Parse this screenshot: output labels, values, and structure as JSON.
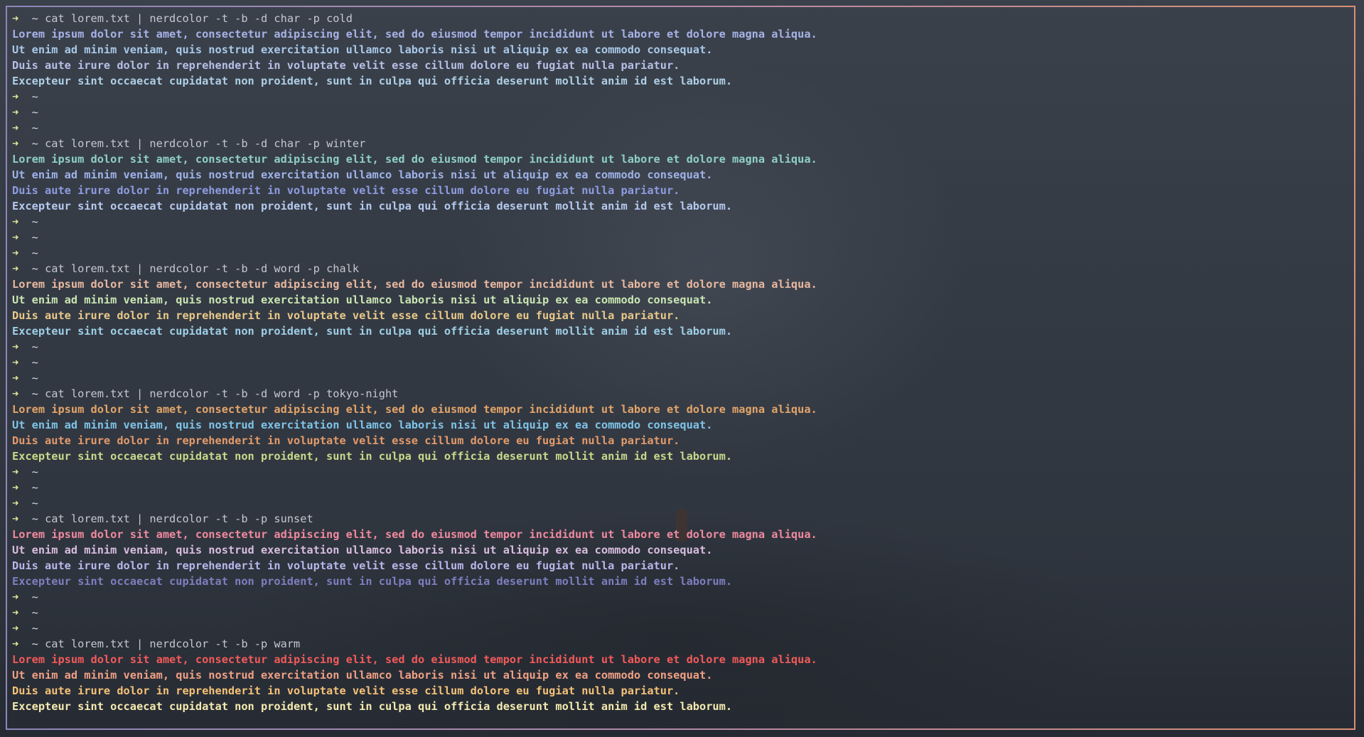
{
  "terminal": {
    "prompt_symbol": "➜",
    "cwd": "~",
    "blocks": [
      {
        "command": "cat lorem.txt | nerdcolor -t -b -d char -p cold",
        "output_lines": [
          {
            "text": "Lorem ipsum dolor sit amet, consectetur adipiscing elit, sed do eiusmod tempor incididunt ut labore et dolore magna aliqua.",
            "color": "#a7b2e6"
          },
          {
            "text": "Ut enim ad minim veniam, quis nostrud exercitation ullamco laboris nisi ut aliquip ex ea commodo consequat.",
            "color": "#a9c8e8"
          },
          {
            "text": "Duis aute irure dolor in reprehenderit in voluptate velit esse cillum dolore eu fugiat nulla pariatur.",
            "color": "#b7bfe6"
          },
          {
            "text": "Excepteur sint occaecat cupidatat non proident, sunt in culpa qui officia deserunt mollit anim id est laborum.",
            "color": "#aecfe6"
          }
        ],
        "empty_prompts": 3
      },
      {
        "command": "cat lorem.txt | nerdcolor -t -b -d char -p winter",
        "output_lines": [
          {
            "text": "Lorem ipsum dolor sit amet, consectetur adipiscing elit, sed do eiusmod tempor incididunt ut labore et dolore magna aliqua.",
            "color": "#8fd0c4"
          },
          {
            "text": "Ut enim ad minim veniam, quis nostrud exercitation ullamco laboris nisi ut aliquip ex ea commodo consequat.",
            "color": "#9fb2e8"
          },
          {
            "text": "Duis aute irure dolor in reprehenderit in voluptate velit esse cillum dolore eu fugiat nulla pariatur.",
            "color": "#8e9ce0"
          },
          {
            "text": "Excepteur sint occaecat cupidatat non proident, sunt in culpa qui officia deserunt mollit anim id est laborum.",
            "color": "#b5c9ee"
          }
        ],
        "empty_prompts": 3
      },
      {
        "command": "cat lorem.txt | nerdcolor -t -b -d word -p chalk",
        "output_lines": [
          {
            "text": "Lorem ipsum dolor sit amet, consectetur adipiscing elit, sed do eiusmod tempor incididunt ut labore et dolore magna aliqua.",
            "color": "#e8b8a0"
          },
          {
            "text": "Ut enim ad minim veniam, quis nostrud exercitation ullamco laboris nisi ut aliquip ex ea commodo consequat.",
            "color": "#c9e6b2"
          },
          {
            "text": "Duis aute irure dolor in reprehenderit in voluptate velit esse cillum dolore eu fugiat nulla pariatur.",
            "color": "#e8c98a"
          },
          {
            "text": "Excepteur sint occaecat cupidatat non proident, sunt in culpa qui officia deserunt mollit anim id est laborum.",
            "color": "#9ecfe6"
          }
        ],
        "empty_prompts": 3
      },
      {
        "command": "cat lorem.txt | nerdcolor -t -b -d word -p tokyo-night",
        "output_lines": [
          {
            "text": "Lorem ipsum dolor sit amet, consectetur adipiscing elit, sed do eiusmod tempor incididunt ut labore et dolore magna aliqua.",
            "color": "#e3a56a"
          },
          {
            "text": "Ut enim ad minim veniam, quis nostrud exercitation ullamco laboris nisi ut aliquip ex ea commodo consequat.",
            "color": "#7fc4e8"
          },
          {
            "text": "Duis aute irure dolor in reprehenderit in voluptate velit esse cillum dolore eu fugiat nulla pariatur.",
            "color": "#e39a6a"
          },
          {
            "text": "Excepteur sint occaecat cupidatat non proident, sunt in culpa qui officia deserunt mollit anim id est laborum.",
            "color": "#c7d98a"
          }
        ],
        "empty_prompts": 3
      },
      {
        "command": "cat lorem.txt | nerdcolor -t -b -p sunset",
        "output_lines": [
          {
            "text": "Lorem ipsum dolor sit amet, consectetur adipiscing elit, sed do eiusmod tempor incididunt ut labore et dolore magna aliqua.",
            "color": "#f08aa0"
          },
          {
            "text": "Ut enim ad minim veniam, quis nostrud exercitation ullamco laboris nisi ut aliquip ex ea commodo consequat.",
            "color": "#d8bde0"
          },
          {
            "text": "Duis aute irure dolor in reprehenderit in voluptate velit esse cillum dolore eu fugiat nulla pariatur.",
            "color": "#b7b7ea"
          },
          {
            "text": "Excepteur sint occaecat cupidatat non proident, sunt in culpa qui officia deserunt mollit anim id est laborum.",
            "color": "#7d7fbf"
          }
        ],
        "empty_prompts": 3
      },
      {
        "command": "cat lorem.txt | nerdcolor -t -b -p warm",
        "output_lines": [
          {
            "text": "Lorem ipsum dolor sit amet, consectetur adipiscing elit, sed do eiusmod tempor incididunt ut labore et dolore magna aliqua.",
            "color": "#f25a5a"
          },
          {
            "text": "Ut enim ad minim veniam, quis nostrud exercitation ullamco laboris nisi ut aliquip ex ea commodo consequat.",
            "color": "#f0a085"
          },
          {
            "text": "Duis aute irure dolor in reprehenderit in voluptate velit esse cillum dolore eu fugiat nulla pariatur.",
            "color": "#f5c178"
          },
          {
            "text": "Excepteur sint occaecat cupidatat non proident, sunt in culpa qui officia deserunt mollit anim id est laborum.",
            "color": "#f5eab0"
          }
        ],
        "empty_prompts": 0
      }
    ]
  }
}
